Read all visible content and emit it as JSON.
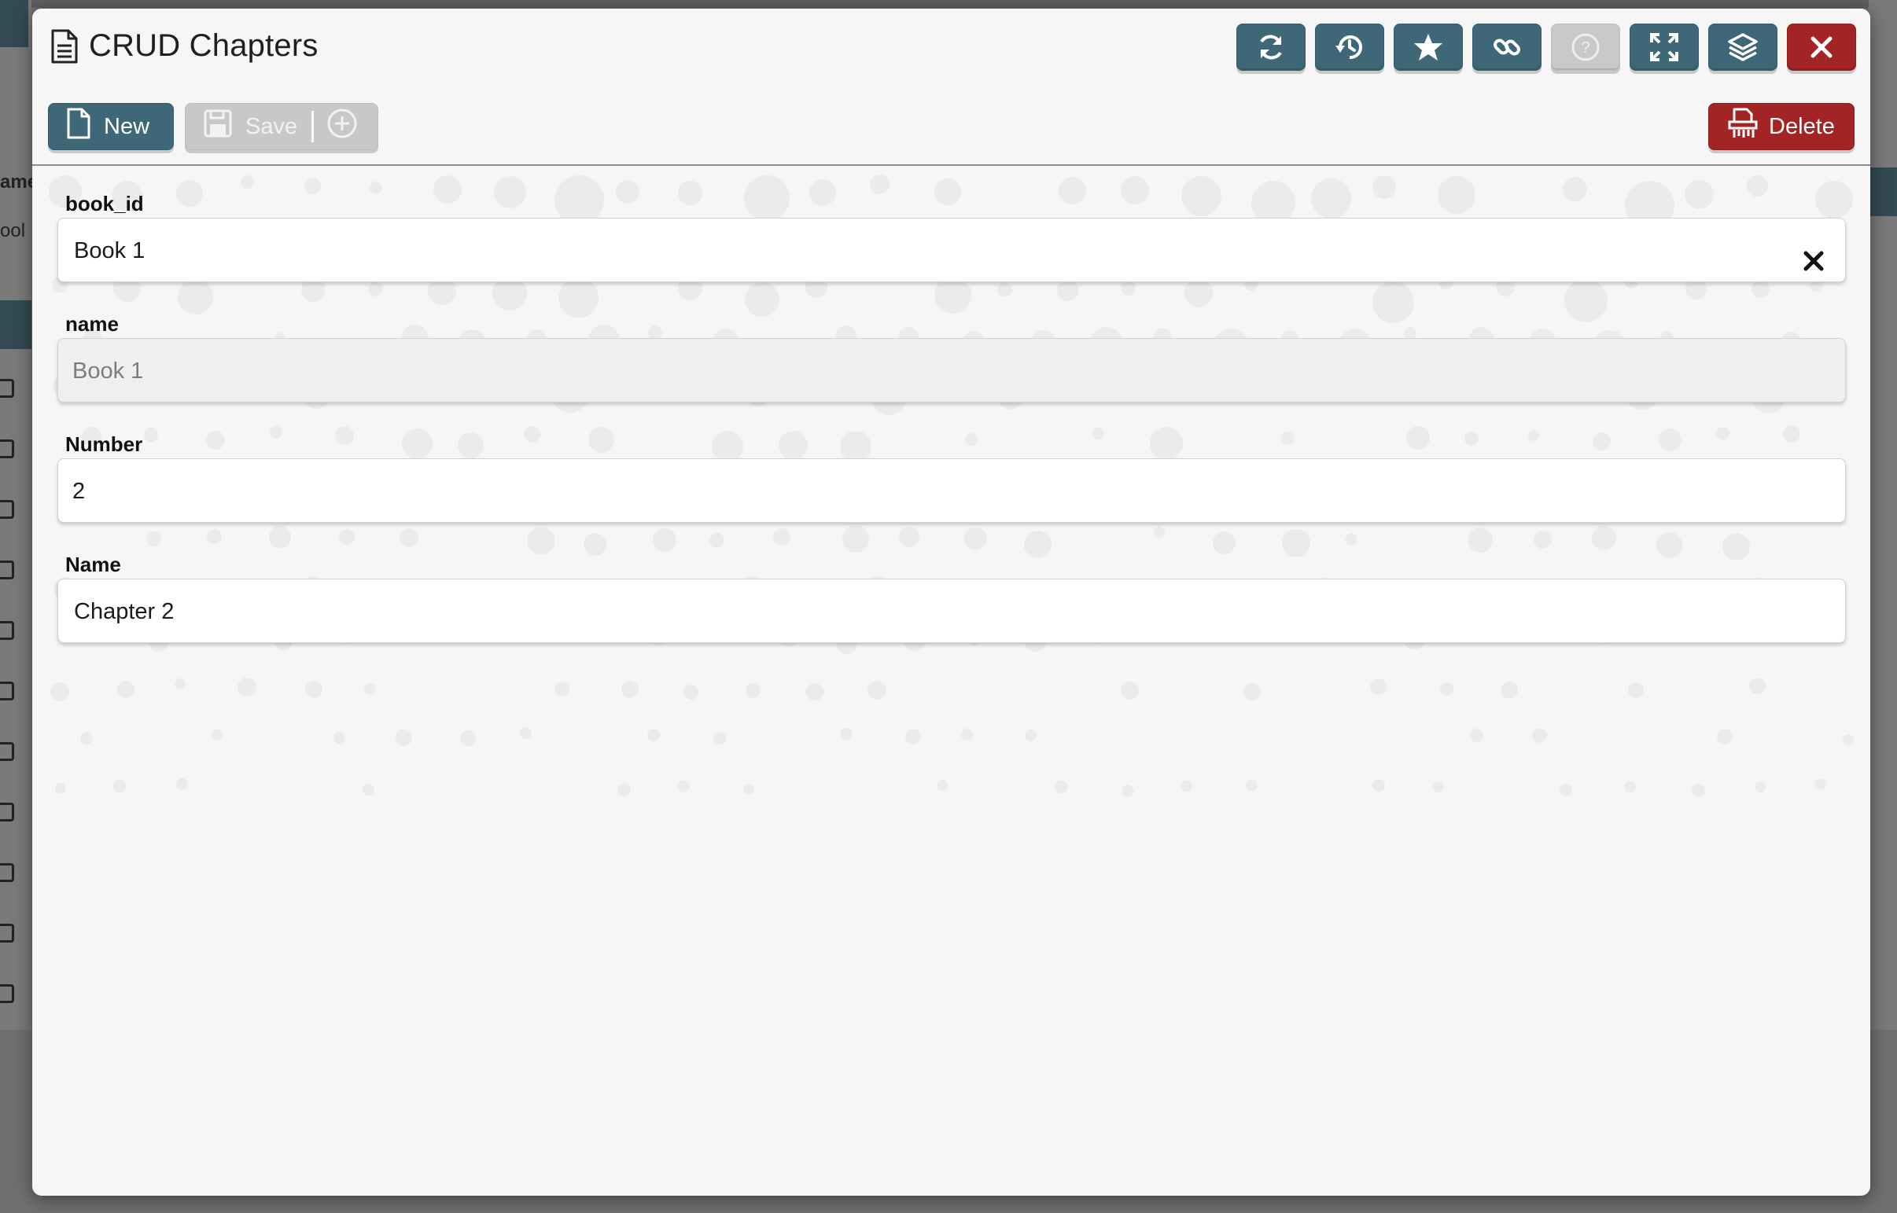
{
  "background": {
    "partial_texts": [
      "ame",
      "ool"
    ]
  },
  "modal": {
    "title": "CRUD Chapters",
    "title_icon": "document-icon",
    "toolbar": [
      {
        "name": "refresh-icon",
        "label": "Refresh"
      },
      {
        "name": "history-icon",
        "label": "History"
      },
      {
        "name": "star-icon",
        "label": "Favorite"
      },
      {
        "name": "link-icon",
        "label": "Link"
      },
      {
        "name": "help-icon",
        "label": "Help",
        "disabled": true
      },
      {
        "name": "fullscreen-icon",
        "label": "Fullscreen"
      },
      {
        "name": "layers-icon",
        "label": "Layers"
      },
      {
        "name": "close-icon",
        "label": "Close"
      }
    ],
    "actions": {
      "new_label": "New",
      "save_label": "Save",
      "delete_label": "Delete"
    },
    "colors": {
      "primary": "#3e6877",
      "danger": "#a32424",
      "disabled": "#c8c8c8",
      "surface": "#f6f6f6"
    }
  },
  "form": {
    "fields": [
      {
        "label": "book_id",
        "value": "Book 1",
        "type": "select-clearable"
      },
      {
        "label": "name",
        "value": "Book 1",
        "type": "readonly"
      },
      {
        "label": "Number",
        "value": "2",
        "type": "number"
      },
      {
        "label": "Name",
        "value": "Chapter 2",
        "type": "text"
      }
    ]
  }
}
